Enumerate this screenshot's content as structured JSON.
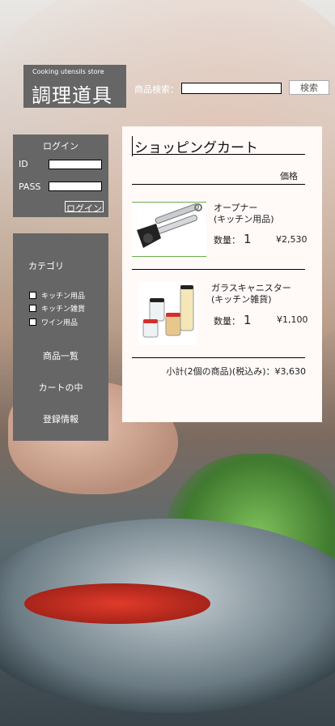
{
  "store": {
    "subtitle": "Cooking utensils store",
    "name": "調理道具"
  },
  "search": {
    "label": "商品検索：",
    "value": "",
    "button": "検索"
  },
  "login": {
    "title": "ログイン",
    "id_label": "ID",
    "pass_label": "PASS",
    "button": "ログイン"
  },
  "sidebar": {
    "category_title": "カテゴリ",
    "categories": [
      {
        "label": "キッチン用品",
        "checked": false
      },
      {
        "label": "キッチン雑貨",
        "checked": false
      },
      {
        "label": "ワイン用品",
        "checked": false
      }
    ],
    "links": [
      "商品一覧",
      "カートの中",
      "登録情報"
    ]
  },
  "cart": {
    "title": "ショッピングカート",
    "price_header": "価格",
    "items": [
      {
        "name_line1": "オープナー",
        "name_line2": "(キッチン用品)",
        "qty_label": "数量：",
        "qty": "1",
        "price": "¥2,530",
        "icon": "can-opener-image"
      },
      {
        "name_line1": "ガラスキャニスター",
        "name_line2": "(キッチン雑貨)",
        "qty_label": "数量：",
        "qty": "1",
        "price": "¥1,100",
        "icon": "glass-canister-image"
      }
    ],
    "subtotal": "小計(2個の商品)(税込み)：¥3,630"
  }
}
